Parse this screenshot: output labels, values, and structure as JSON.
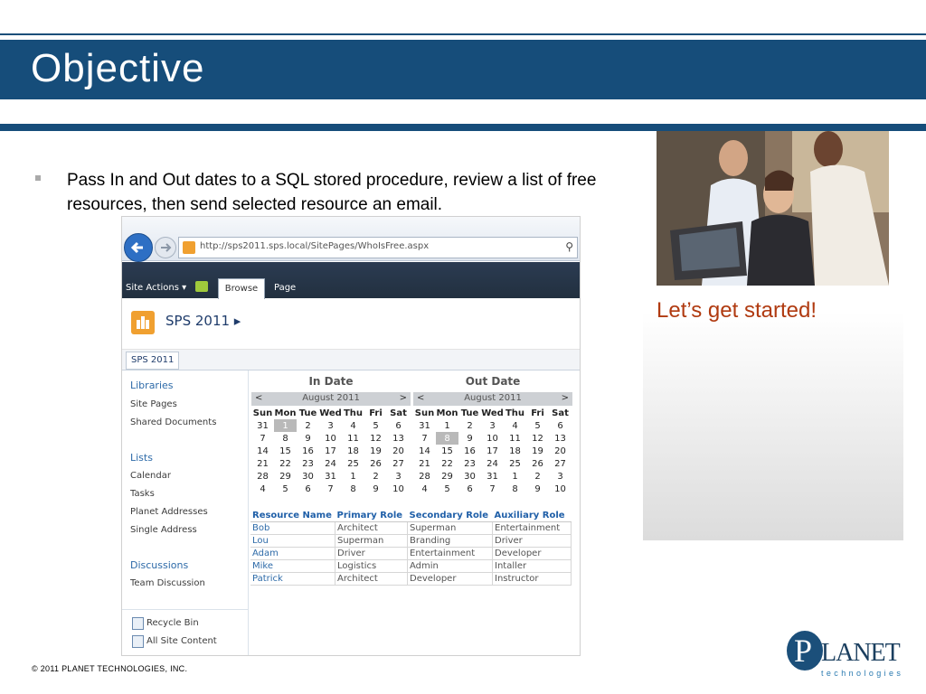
{
  "slide": {
    "title": "Objective",
    "bullet": "Pass In and Out dates to a SQL stored procedure, review a list of free resources, then send selected resource an email.",
    "cta": "Let’s get started!",
    "copyright": "© 2011  PLANET  TECHNOLOGIES,  INC.",
    "logo": {
      "word": "LANET",
      "initial": "P",
      "tagline": "technologies"
    }
  },
  "browser": {
    "url": "http://sps2011.sps.local/SitePages/WhoIsFree.aspx"
  },
  "ribbon": {
    "site_actions": "Site Actions ▾",
    "tabs": [
      "Browse",
      "Page"
    ]
  },
  "site": {
    "title": "SPS 2011 ▸",
    "topnav_item": "SPS 2011"
  },
  "quicklaunch": {
    "libraries": "Libraries",
    "site_pages": "Site Pages",
    "shared_documents": "Shared Documents",
    "lists": "Lists",
    "calendar": "Calendar",
    "tasks": "Tasks",
    "planet_addresses": "Planet Addresses",
    "single_address": "Single Address",
    "discussions": "Discussions",
    "team_discussion": "Team Discussion",
    "recycle_bin": "Recycle Bin",
    "all_site_content": "All Site Content"
  },
  "calendars": [
    {
      "title": "In Date",
      "prev": "<",
      "month": "August 2011",
      "next": ">",
      "days": [
        "Sun",
        "Mon",
        "Tue",
        "Wed",
        "Thu",
        "Fri",
        "Sat"
      ],
      "weeks": [
        [
          "31",
          "1",
          "2",
          "3",
          "4",
          "5",
          "6"
        ],
        [
          "7",
          "8",
          "9",
          "10",
          "11",
          "12",
          "13"
        ],
        [
          "14",
          "15",
          "16",
          "17",
          "18",
          "19",
          "20"
        ],
        [
          "21",
          "22",
          "23",
          "24",
          "25",
          "26",
          "27"
        ],
        [
          "28",
          "29",
          "30",
          "31",
          "1",
          "2",
          "3"
        ],
        [
          "4",
          "5",
          "6",
          "7",
          "8",
          "9",
          "10"
        ]
      ],
      "selected": "1"
    },
    {
      "title": "Out Date",
      "prev": "<",
      "month": "August 2011",
      "next": ">",
      "days": [
        "Sun",
        "Mon",
        "Tue",
        "Wed",
        "Thu",
        "Fri",
        "Sat"
      ],
      "weeks": [
        [
          "31",
          "1",
          "2",
          "3",
          "4",
          "5",
          "6"
        ],
        [
          "7",
          "8",
          "9",
          "10",
          "11",
          "12",
          "13"
        ],
        [
          "14",
          "15",
          "16",
          "17",
          "18",
          "19",
          "20"
        ],
        [
          "21",
          "22",
          "23",
          "24",
          "25",
          "26",
          "27"
        ],
        [
          "28",
          "29",
          "30",
          "31",
          "1",
          "2",
          "3"
        ],
        [
          "4",
          "5",
          "6",
          "7",
          "8",
          "9",
          "10"
        ]
      ],
      "selected": "8"
    }
  ],
  "resources": {
    "headers": [
      "Resource Name",
      "Primary Role",
      "Secondary Role",
      "Auxiliary Role"
    ],
    "rows": [
      [
        "Bob",
        "Architect",
        "Superman",
        "Entertainment"
      ],
      [
        "Lou",
        "Superman",
        "Branding",
        "Driver"
      ],
      [
        "Adam",
        "Driver",
        "Entertainment",
        "Developer"
      ],
      [
        "Mike",
        "Logistics",
        "Admin",
        "Intaller"
      ],
      [
        "Patrick",
        "Architect",
        "Developer",
        "Instructor"
      ]
    ]
  },
  "icons": [
    "back-arrow-icon",
    "forward-arrow-icon",
    "page-icon",
    "search-icon",
    "edit-icon",
    "site-logo-icon",
    "recycle-bin-icon",
    "all-site-content-icon"
  ]
}
